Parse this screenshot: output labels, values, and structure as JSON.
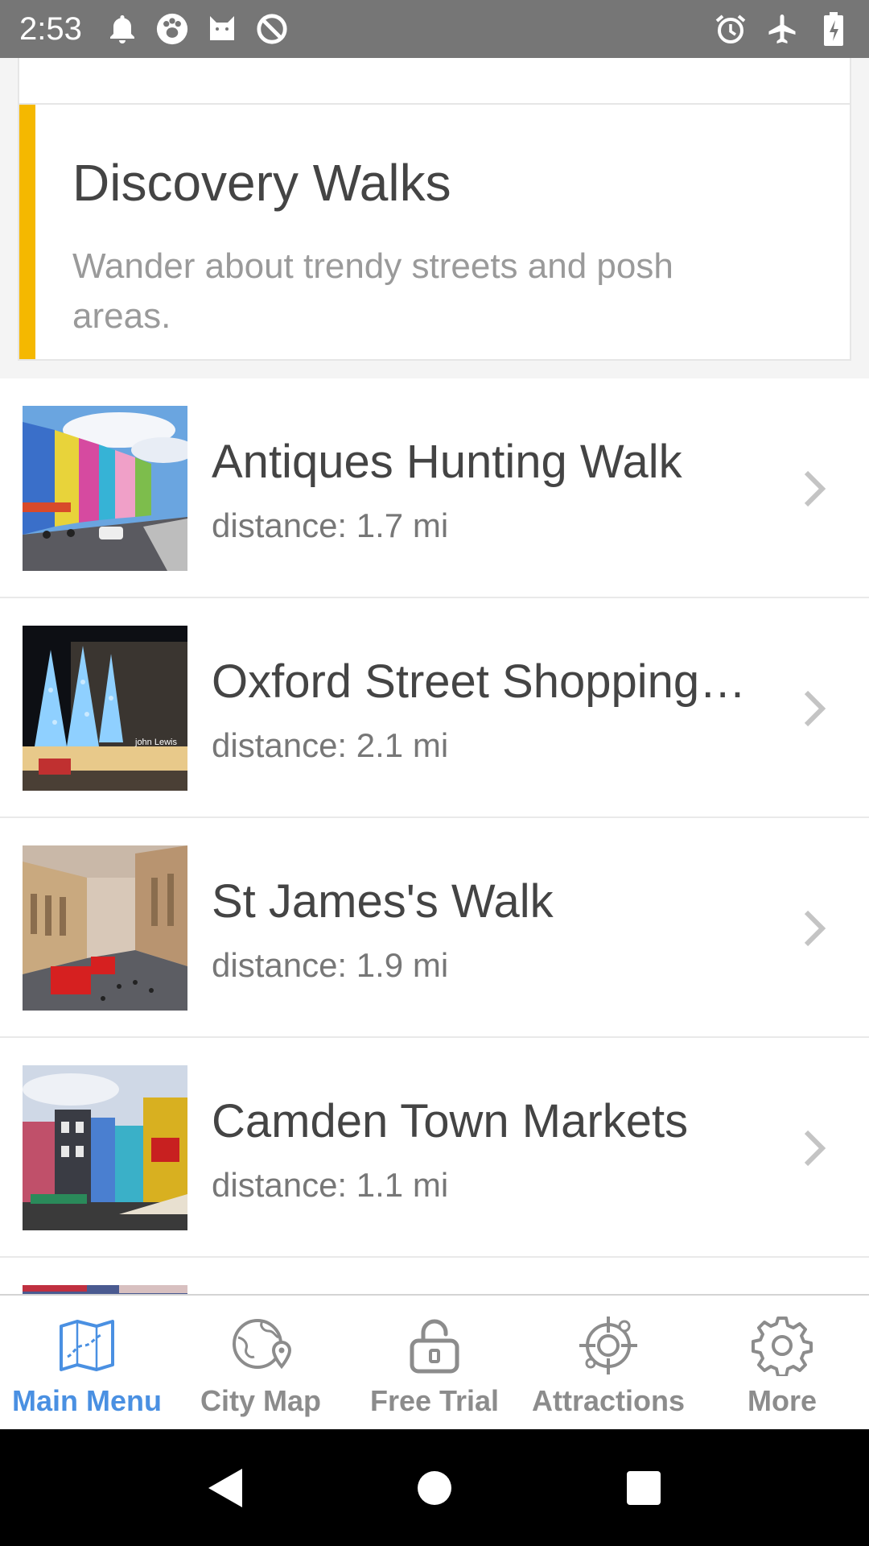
{
  "status_bar": {
    "time": "2:53",
    "left_icons": [
      "bell-icon",
      "paw-icon",
      "cat-icon",
      "no-sync-icon"
    ],
    "right_icons": [
      "alarm-icon",
      "airplane-icon",
      "battery-charging-icon"
    ]
  },
  "section": {
    "title": "Discovery Walks",
    "description": "Wander about trendy streets and posh areas.",
    "accent_color": "#f5b800"
  },
  "walks": [
    {
      "title": "Antiques Hunting Walk",
      "distance": "distance: 1.7 mi",
      "thumbnail": "colorful-street-photo"
    },
    {
      "title": "Oxford Street Shopping…",
      "distance": "distance: 2.1 mi",
      "thumbnail": "christmas-lights-store-photo"
    },
    {
      "title": "St James's Walk",
      "distance": "distance: 1.9 mi",
      "thumbnail": "street-with-red-buses-photo"
    },
    {
      "title": "Camden Town Markets",
      "distance": "distance: 1.1 mi",
      "thumbnail": "camden-shops-photo"
    }
  ],
  "bottom_nav": {
    "items": [
      {
        "label": "Main Menu",
        "icon": "map-icon",
        "active": true
      },
      {
        "label": "City Map",
        "icon": "globe-pin-icon",
        "active": false
      },
      {
        "label": "Free Trial",
        "icon": "unlock-icon",
        "active": false
      },
      {
        "label": "Attractions",
        "icon": "crosshair-icon",
        "active": false
      },
      {
        "label": "More",
        "icon": "gear-icon",
        "active": false
      }
    ],
    "active_color": "#4a90e2",
    "inactive_color": "#8c8c8c"
  }
}
